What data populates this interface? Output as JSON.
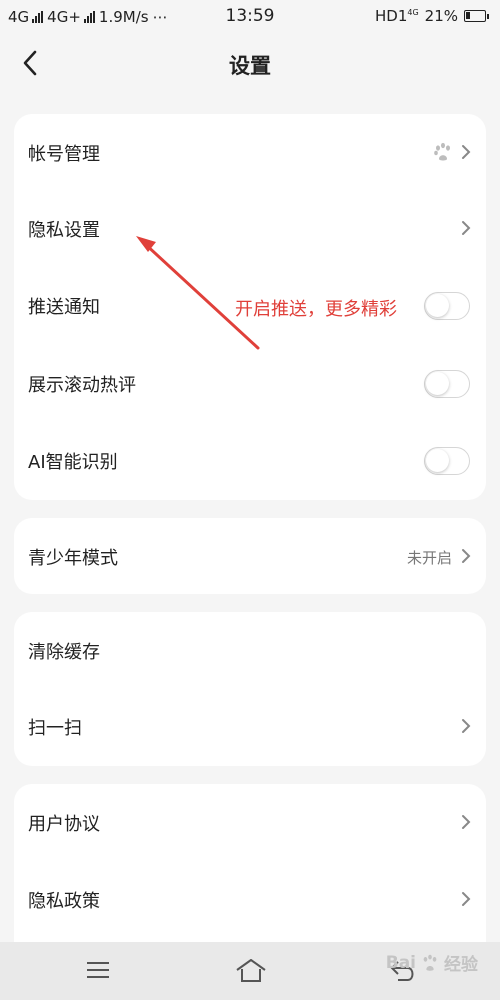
{
  "status_bar": {
    "net1": "4G",
    "net2": "4G+",
    "speed": "1.9M/s",
    "more": "⋯",
    "time": "13:59",
    "hd": "HD1",
    "hd_sub": "4G",
    "battery_percent": "21%",
    "battery_level": 0.21
  },
  "header": {
    "title": "设置",
    "back_icon": "chevron-left-icon"
  },
  "card1": {
    "items": [
      {
        "label": "帐号管理",
        "type": "link",
        "icon": "paw-icon"
      },
      {
        "label": "隐私设置",
        "type": "link"
      },
      {
        "label": "推送通知",
        "type": "toggle",
        "on": false
      },
      {
        "label": "展示滚动热评",
        "type": "toggle",
        "on": false
      },
      {
        "label": "AI智能识别",
        "type": "toggle",
        "on": false
      }
    ]
  },
  "card2": {
    "items": [
      {
        "label": "青少年模式",
        "type": "link",
        "value": "未开启"
      }
    ]
  },
  "card3": {
    "items": [
      {
        "label": "清除缓存",
        "type": "action"
      },
      {
        "label": "扫一扫",
        "type": "link"
      }
    ]
  },
  "card4": {
    "items": [
      {
        "label": "用户协议",
        "type": "link"
      },
      {
        "label": "隐私政策",
        "type": "link"
      }
    ]
  },
  "annotation": {
    "text": "开启推送，更多精彩",
    "color": "#e0403a"
  },
  "bottom_nav": {
    "icons": [
      "menu-icon",
      "home-icon",
      "back-icon"
    ]
  },
  "watermark": {
    "text": "Bai",
    "suffix": "经验"
  }
}
